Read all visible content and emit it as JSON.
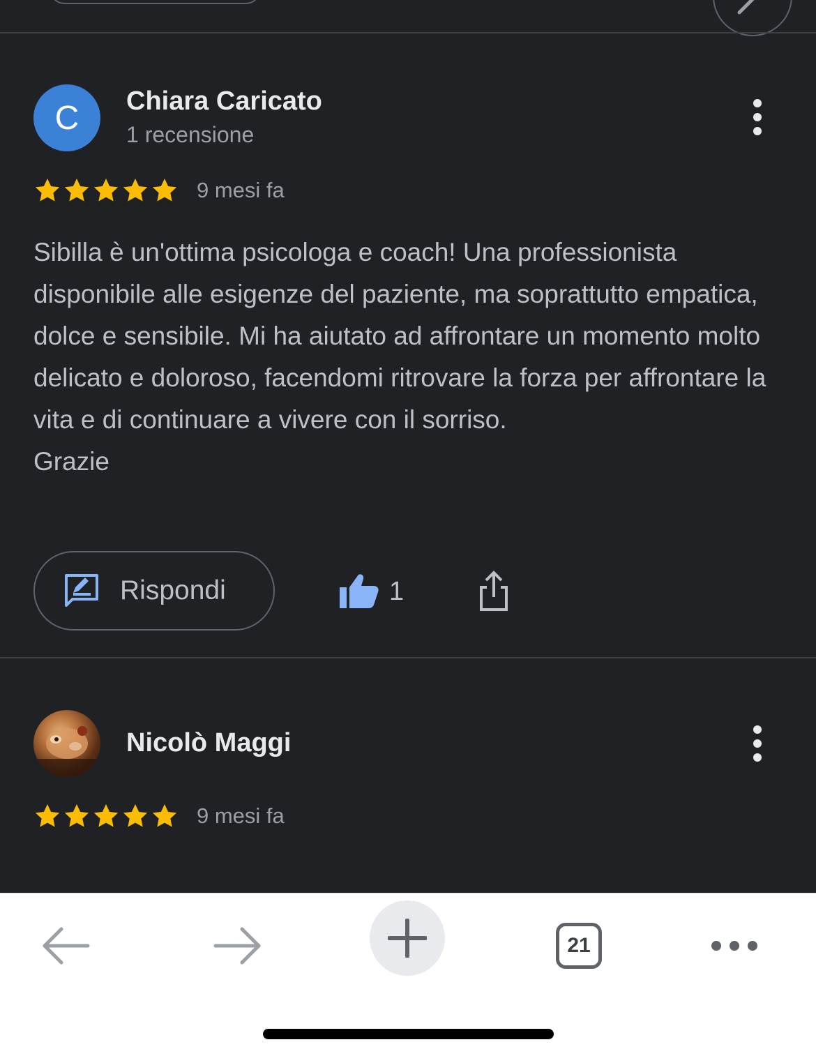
{
  "reviews": [
    {
      "author": "Chiara Caricato",
      "avatar_letter": "C",
      "meta": "1 recensione",
      "rating": 5,
      "time": "9 mesi fa",
      "text_lines": [
        "Sibilla è un'ottima psicologa e coach! Una professionista disponibile alle esigenze del paziente, ma soprattutto empatica, dolce e sensibile. Mi ha aiutato ad affrontare un momento molto delicato e doloroso, facendomi ritrovare la forza per affrontare la vita e di continuare a vivere con il sorriso.",
        "Grazie"
      ],
      "reply_label": "Rispondi",
      "like_count": "1"
    },
    {
      "author": "Nicolò Maggi",
      "rating": 5,
      "time": "9 mesi fa"
    }
  ],
  "browser_bar": {
    "back_icon": "arrow-left-icon",
    "forward_icon": "arrow-right-icon",
    "new_tab_icon": "plus-icon",
    "tab_count": "21",
    "menu_icon": "more-horizontal-icon"
  },
  "colors": {
    "background": "#202124",
    "star": "#fbbc04",
    "avatar": "#3b82d6",
    "like": "#8ab4f8",
    "reply_icon": "#8ab4f8"
  }
}
